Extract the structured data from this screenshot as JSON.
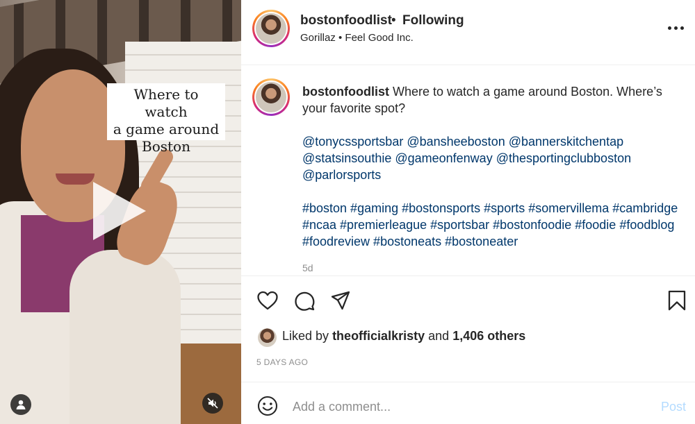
{
  "video": {
    "overlay_text": [
      "Where to watch",
      "a game around",
      "Boston"
    ],
    "icons": {
      "play": "play-icon",
      "tag": "person-tag-icon",
      "mute": "sound-off-icon"
    }
  },
  "header": {
    "username": "bostonfoodlist",
    "separator": "•",
    "follow_status": "Following",
    "audio": "Gorillaz • Feel Good Inc.",
    "more_icon": "more-options-icon"
  },
  "caption": {
    "username": "bostonfoodlist",
    "text": "Where to watch a game around Boston. Where’s your favorite spot?",
    "mentions": "@tonycssportsbar @bansheeboston @bannerskitchentap @statsinsouthie @gameonfenway @thesportingclubboston @parlorsports",
    "hashtags": "#boston #gaming #bostonsports #sports #somervillema #cambridge #ncaa #premierleague #sportsbar #bostonfoodie #foodie #foodblog #foodreview #bostoneats #bostoneater",
    "age": "5d"
  },
  "actions": {
    "icons": [
      "heart-icon",
      "comment-icon",
      "share-icon",
      "bookmark-icon"
    ]
  },
  "likes": {
    "prefix": "Liked by",
    "user": "theofficialkristy",
    "conjunction": "and",
    "others": "1,406 others"
  },
  "date": "5 DAYS AGO",
  "comment_box": {
    "placeholder": "Add a comment...",
    "post_label": "Post",
    "emoji_icon": "emoji-icon"
  },
  "colors": {
    "text": "#262626",
    "link": "#00376b",
    "muted": "#8e8e8e",
    "post_disabled": "#b3dbff"
  }
}
